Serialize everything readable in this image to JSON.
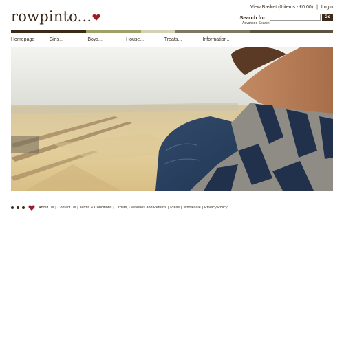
{
  "site": {
    "logo_text": "rowpinto..."
  },
  "header": {
    "basket_link": "View Basket (0 items - £0.00)",
    "separator": "|",
    "login_link": "Login",
    "search_label": "Search for:",
    "search_value": "",
    "go_button": "Go",
    "advanced_search": "Advanced Search"
  },
  "color_bar": [
    "#3b2a1a",
    "#9fa068",
    "#d5d1b5",
    "#807865",
    "#5a5440"
  ],
  "nav": {
    "items": [
      {
        "label": "Homepage"
      },
      {
        "label": "Girls..."
      },
      {
        "label": "Boys..."
      },
      {
        "label": "House..."
      },
      {
        "label": "Treats..."
      },
      {
        "label": "Information..."
      }
    ]
  },
  "hero": {
    "description_icon": "hero-photo"
  },
  "footer": {
    "links": [
      {
        "label": "About Us"
      },
      {
        "label": "Contact Us"
      },
      {
        "label": "Terms & Conditions"
      },
      {
        "label": "Orders, Deliveries and Returns"
      },
      {
        "label": "Press"
      },
      {
        "label": "Wholesale"
      },
      {
        "label": "Privacy Policy"
      }
    ],
    "separator": "|"
  },
  "colors": {
    "brand_dark": "#3b2a1a",
    "heart_red": "#9b1c24"
  }
}
